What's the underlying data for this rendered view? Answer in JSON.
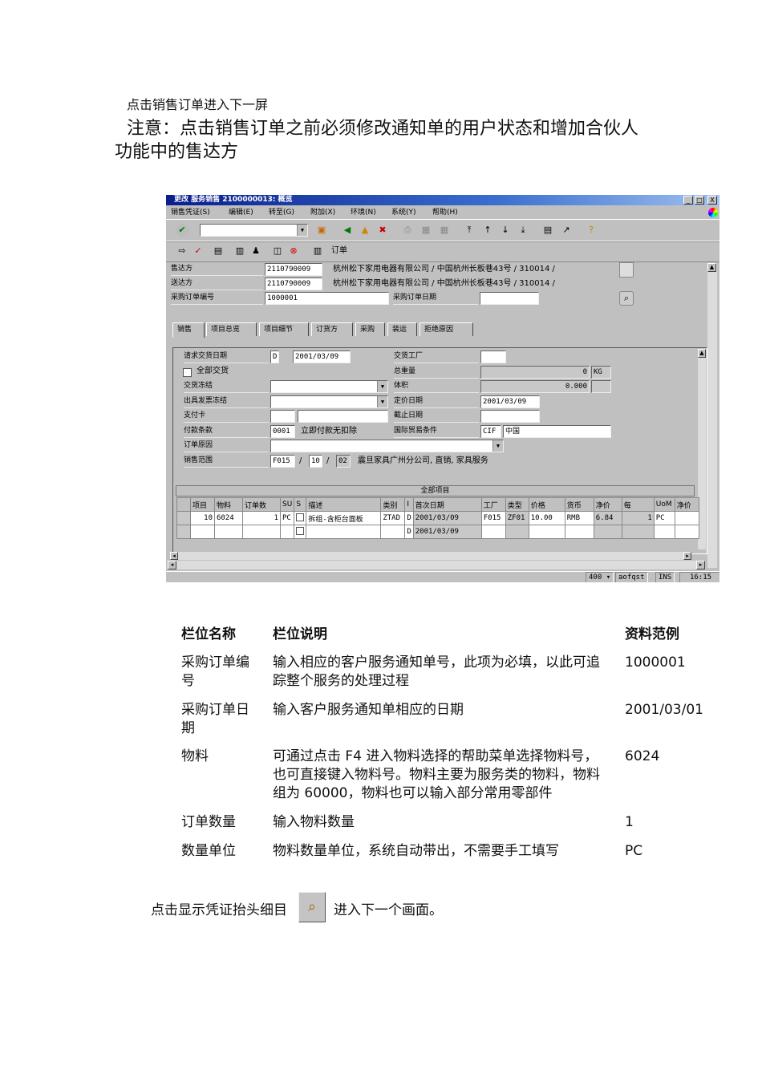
{
  "doc": {
    "line1": "点击销售订单进入下一屏",
    "note_line1": "注意：点击销售订单之前必须修改通知单的用户状态和增加合伙人",
    "note_line2": "功能中的售达方",
    "field_table": {
      "headers": [
        "栏位名称",
        "栏位说明",
        "资料范例"
      ],
      "rows": [
        {
          "name": "采购订单编号",
          "desc": "输入相应的客户服务通知单号，此项为必填，以此可追踪整个服务的处理过程",
          "example": "1000001"
        },
        {
          "name": "采购订单日期",
          "desc": "输入客户服务通知单相应的日期",
          "example": "2001/03/01"
        },
        {
          "name": "物料",
          "desc": "可通过点击 F4 进入物料选择的帮助菜单选择物料号，也可直接键入物料号。物料主要为服务类的物料，物料组为 60000，物料也可以输入部分常用零部件",
          "example": "6024"
        },
        {
          "name": "订单数量",
          "desc": "输入物料数量",
          "example": "1"
        },
        {
          "name": "数量单位",
          "desc": "物料数量单位，系统自动带出，不需要手工填写",
          "example": "PC"
        }
      ]
    },
    "bottom_before": "点击显示凭证抬头细目",
    "bottom_after": "进入下一个画面。"
  },
  "sap": {
    "title": "更改 服务销售 2100000013: 概览",
    "window_buttons": [
      "_",
      "□",
      "X"
    ],
    "menu": [
      "销售凭证(S)",
      "编辑(E)",
      "转至(G)",
      "附加(X)",
      "环境(N)",
      "系统(Y)",
      "帮助(H)"
    ],
    "toolbar2_label": "订单",
    "header": {
      "sold_to_label": "售达方",
      "sold_to": "2110790009",
      "sold_to_desc": "杭州松下家用电器有限公司 / 中国杭州长板巷43号 / 310014 /",
      "ship_to_label": "送达方",
      "ship_to": "2110790009",
      "ship_to_desc": "杭州松下家用电器有限公司 / 中国杭州长板巷43号 / 310014 /",
      "po_number_label": "采购订单编号",
      "po_number": "1000001",
      "po_date_label": "采购订单日期",
      "po_date": ""
    },
    "tabs": [
      "销售",
      "项目总览",
      "项目细节",
      "订货方",
      "采购",
      "装运",
      "拒绝原因"
    ],
    "sales": {
      "req_date_label": "请求交货日期",
      "req_date_type": "D",
      "req_date": "2001/03/09",
      "complete_label": "全部交货",
      "delivery_block_label": "交货冻结",
      "billing_block_label": "出具发票冻结",
      "payment_card_label": "支付卡",
      "payment_terms_label": "付款条款",
      "payment_terms": "0001",
      "payment_terms_desc": "立即付款无扣除",
      "order_reason_label": "订单原因",
      "sales_area_label": "销售范围",
      "sales_org": "F015",
      "dist_channel": "10",
      "division": "02",
      "sales_area_desc": "震旦家具广州分公司, 直销, 家具服务",
      "plant_label": "交货工厂",
      "plant": "",
      "weight_label": "总重量",
      "weight": "0",
      "weight_unit": "KG",
      "volume_label": "体积",
      "volume": "0.000",
      "pricing_date_label": "定价日期",
      "pricing_date": "2001/03/09",
      "valid_to_label": "截止日期",
      "incoterms_label": "国际贸易条件",
      "incoterms": "CIF",
      "incoterms2": "中国",
      "slash": "/"
    },
    "items": {
      "title": "全部项目",
      "columns": [
        "项目",
        "物料",
        "订单数",
        "SU",
        "S",
        "描述",
        "类别",
        "I",
        "首次日期",
        "工厂",
        "类型",
        "价格",
        "货币",
        "净价",
        "每",
        "UoM",
        "净价"
      ],
      "rows": [
        [
          "10",
          "6024",
          "1",
          "PC",
          "",
          "拆组-含柜台面板",
          "ZTAD",
          "D",
          "2001/03/09",
          "F015",
          "ZF01",
          "10.00",
          "RMB",
          "6.84",
          "1",
          "PC",
          ""
        ],
        [
          "",
          "",
          "",
          "",
          "",
          "",
          "",
          "D",
          "2001/03/09",
          "",
          "",
          "",
          "",
          "",
          "",
          "",
          ""
        ]
      ]
    },
    "status": {
      "client": "400",
      "server": "aofqst",
      "mode": "INS",
      "time": "16:15"
    }
  }
}
